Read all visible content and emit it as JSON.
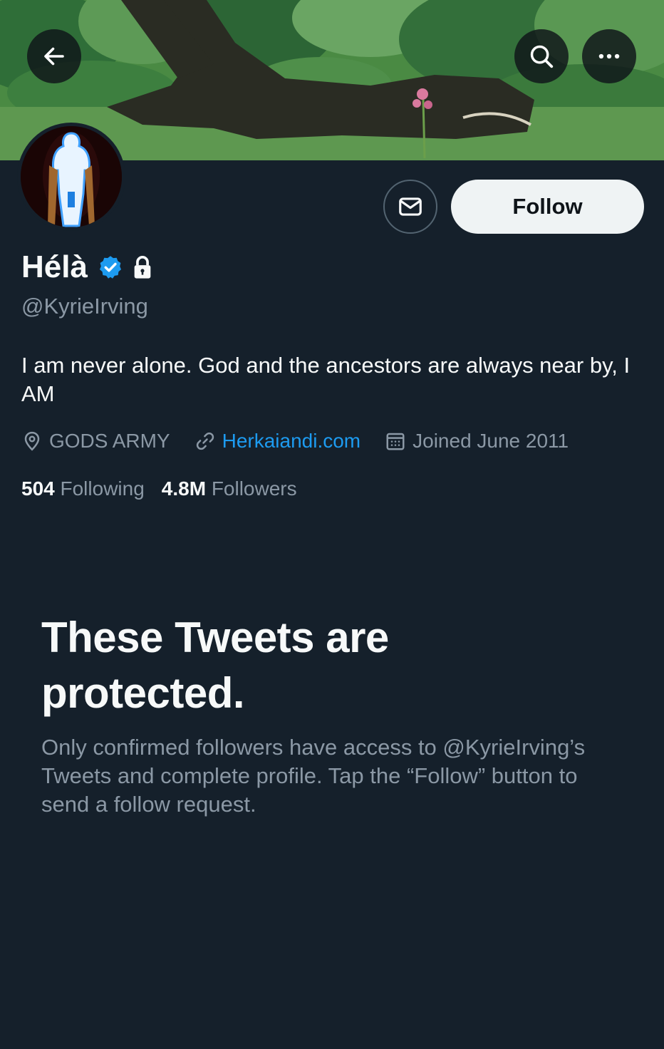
{
  "header": {
    "back_icon": "arrow-left-icon",
    "search_icon": "search-icon",
    "more_icon": "more-horizontal-icon"
  },
  "profile": {
    "display_name": "Hélà",
    "handle": "@KyrieIrving",
    "verified": true,
    "protected": true,
    "bio": "I am never alone. God and the ancestors are always near by, I AM",
    "location": "GODS ARMY",
    "website": "Herkaiandi.com",
    "joined": "Joined June 2011",
    "following_count": "504",
    "following_label": "Following",
    "followers_count": "4.8M",
    "followers_label": "Followers"
  },
  "actions": {
    "message_icon": "envelope-icon",
    "follow_label": "Follow"
  },
  "protected_notice": {
    "title": "These Tweets are protected.",
    "body": "Only confirmed followers have access to @KyrieIrving’s Tweets and complete profile. Tap the “Follow” button to send a follow request."
  },
  "colors": {
    "background": "#15202b",
    "accent": "#1d9bf0",
    "muted_text": "#8b98a5",
    "follow_button_bg": "#eff3f4"
  }
}
